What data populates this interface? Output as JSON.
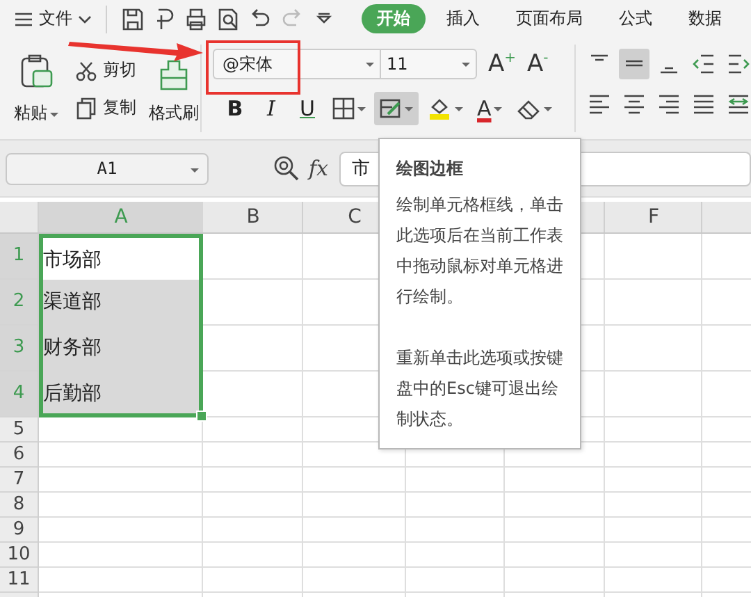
{
  "menu": {
    "label": "文件"
  },
  "tabs": [
    {
      "label": "开始",
      "selected": true
    },
    {
      "label": "插入",
      "selected": false
    },
    {
      "label": "页面布局",
      "selected": false
    },
    {
      "label": "公式",
      "selected": false
    },
    {
      "label": "数据",
      "selected": false
    }
  ],
  "clipboard": {
    "paste": "粘贴",
    "cut": "剪切",
    "copy": "复制",
    "format_painter": "格式刷"
  },
  "font": {
    "name": "@宋体",
    "size": "11",
    "grow": "A$^{+}$",
    "shrink": "A$^{-}$"
  },
  "font_tools": [
    {
      "kind": "bold",
      "label": "B",
      "active": false
    },
    {
      "kind": "italic",
      "label": "I",
      "active": false
    },
    {
      "kind": "underline",
      "label": "U",
      "active": false
    },
    {
      "kind": "borders",
      "active": false
    },
    {
      "kind": "draw-border",
      "active": true
    },
    {
      "kind": "fill-color",
      "active": false
    },
    {
      "kind": "font-color",
      "label": "A",
      "active": false
    },
    {
      "kind": "clear",
      "active": false
    }
  ],
  "align_tools": [
    {
      "kind": "top",
      "active": false
    },
    {
      "kind": "middle",
      "active": true
    },
    {
      "kind": "bottom",
      "active": false
    },
    {
      "kind": "outdent",
      "active": false
    },
    {
      "kind": "indent",
      "active": false
    },
    {
      "kind": "left",
      "active": false
    },
    {
      "kind": "center",
      "active": false
    },
    {
      "kind": "right",
      "active": false
    },
    {
      "kind": "justify",
      "active": false
    },
    {
      "kind": "distribute",
      "active": false
    }
  ],
  "formula_bar": {
    "name_box": "A1",
    "function_label": "fx",
    "value": "市"
  },
  "sheet": {
    "columns": [
      {
        "label": "A",
        "selected": true
      },
      {
        "label": "B",
        "selected": false
      },
      {
        "label": "C",
        "selected": false
      },
      {
        "label": "F",
        "selected": false
      }
    ],
    "rows": [
      {
        "label": "1",
        "value": "市场部",
        "selected": true,
        "active": true
      },
      {
        "label": "2",
        "value": "渠道部",
        "selected": true,
        "active": false
      },
      {
        "label": "3",
        "value": "财务部",
        "selected": true,
        "active": false
      },
      {
        "label": "4",
        "value": "后勤部",
        "selected": true,
        "active": false
      },
      {
        "label": "5",
        "selected": false
      },
      {
        "label": "6",
        "selected": false
      },
      {
        "label": "7",
        "selected": false
      },
      {
        "label": "8",
        "selected": false
      },
      {
        "label": "9",
        "selected": false
      },
      {
        "label": "10",
        "selected": false
      },
      {
        "label": "11",
        "selected": false
      }
    ]
  },
  "tooltip": {
    "title": "绘图边框",
    "paragraphs": [
      "绘制单元格框线，单击此选项后在当前工作表中拖动鼠标对单元格进行绘制。",
      "重新单击此选项或按键盘中的Esc键可退出绘制状态。"
    ]
  }
}
